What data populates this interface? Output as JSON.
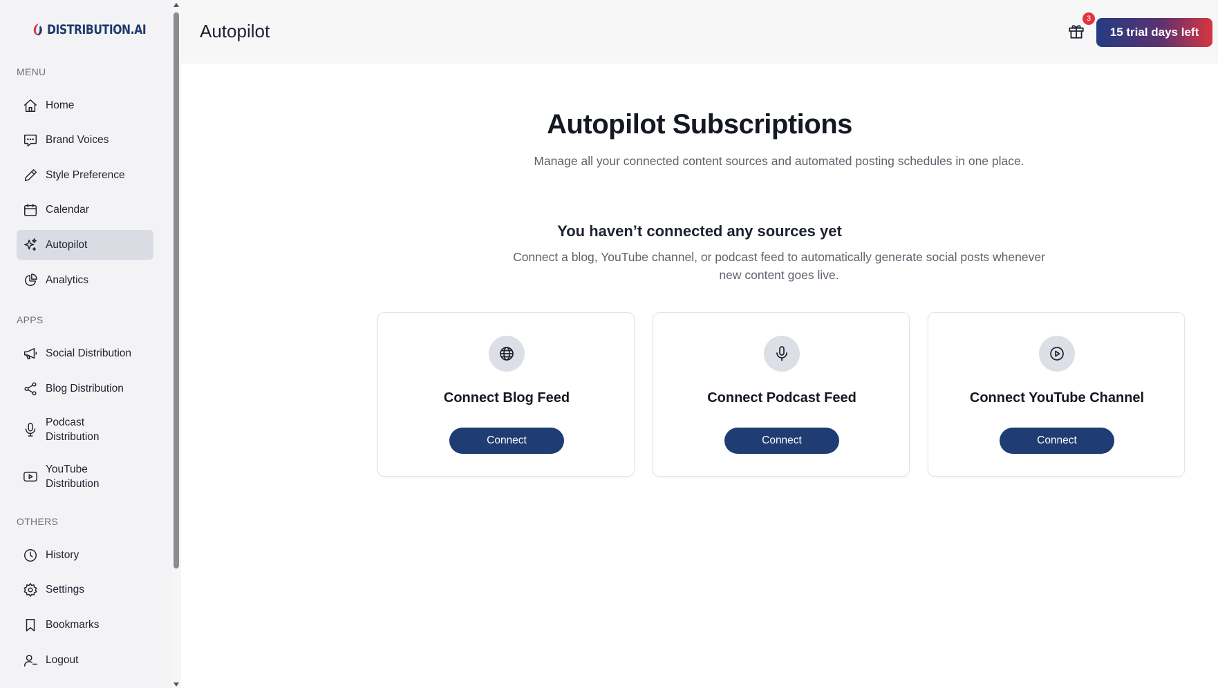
{
  "brand": {
    "name": "DISTRIBUTION.AI"
  },
  "sidebar": {
    "menu_label": "MENU",
    "menu_items": [
      {
        "label": "Home",
        "icon": "home-icon"
      },
      {
        "label": "Brand Voices",
        "icon": "message-icon"
      },
      {
        "label": "Style Preference",
        "icon": "pencil-icon"
      },
      {
        "label": "Calendar",
        "icon": "calendar-icon"
      },
      {
        "label": "Autopilot",
        "icon": "sparkles-icon",
        "active": true
      },
      {
        "label": "Analytics",
        "icon": "pie-chart-icon"
      }
    ],
    "apps_label": "APPS",
    "apps_items": [
      {
        "label": "Social Distribution",
        "icon": "megaphone-icon"
      },
      {
        "label": "Blog Distribution",
        "icon": "share-icon"
      },
      {
        "label": "Podcast Distribution",
        "icon": "microphone-icon"
      },
      {
        "label": "YouTube Distribution",
        "icon": "youtube-icon"
      }
    ],
    "others_label": "OTHERS",
    "others_items": [
      {
        "label": "History",
        "icon": "clock-icon"
      },
      {
        "label": "Settings",
        "icon": "gear-icon"
      },
      {
        "label": "Bookmarks",
        "icon": "bookmark-icon"
      },
      {
        "label": "Logout",
        "icon": "logout-icon"
      }
    ]
  },
  "header": {
    "title": "Autopilot",
    "gift_badge_count": "3",
    "trial_label": "15 trial days left"
  },
  "main": {
    "title": "Autopilot Subscriptions",
    "subtitle": "Manage all your connected content sources and automated posting schedules in one place.",
    "empty_title": "You haven’t connected any sources yet",
    "empty_subtitle": "Connect a blog, YouTube channel, or podcast feed to automatically generate social posts whenever new content goes live.",
    "cards": [
      {
        "title": "Connect Blog Feed",
        "button": "Connect",
        "icon": "globe-icon"
      },
      {
        "title": "Connect Podcast Feed",
        "button": "Connect",
        "icon": "microphone-icon"
      },
      {
        "title": "Connect YouTube Channel",
        "button": "Connect",
        "icon": "play-circle-icon"
      }
    ]
  },
  "colors": {
    "primary_button": "#1f3c73",
    "active_nav": "#d9dce3",
    "badge": "#e0353f"
  }
}
